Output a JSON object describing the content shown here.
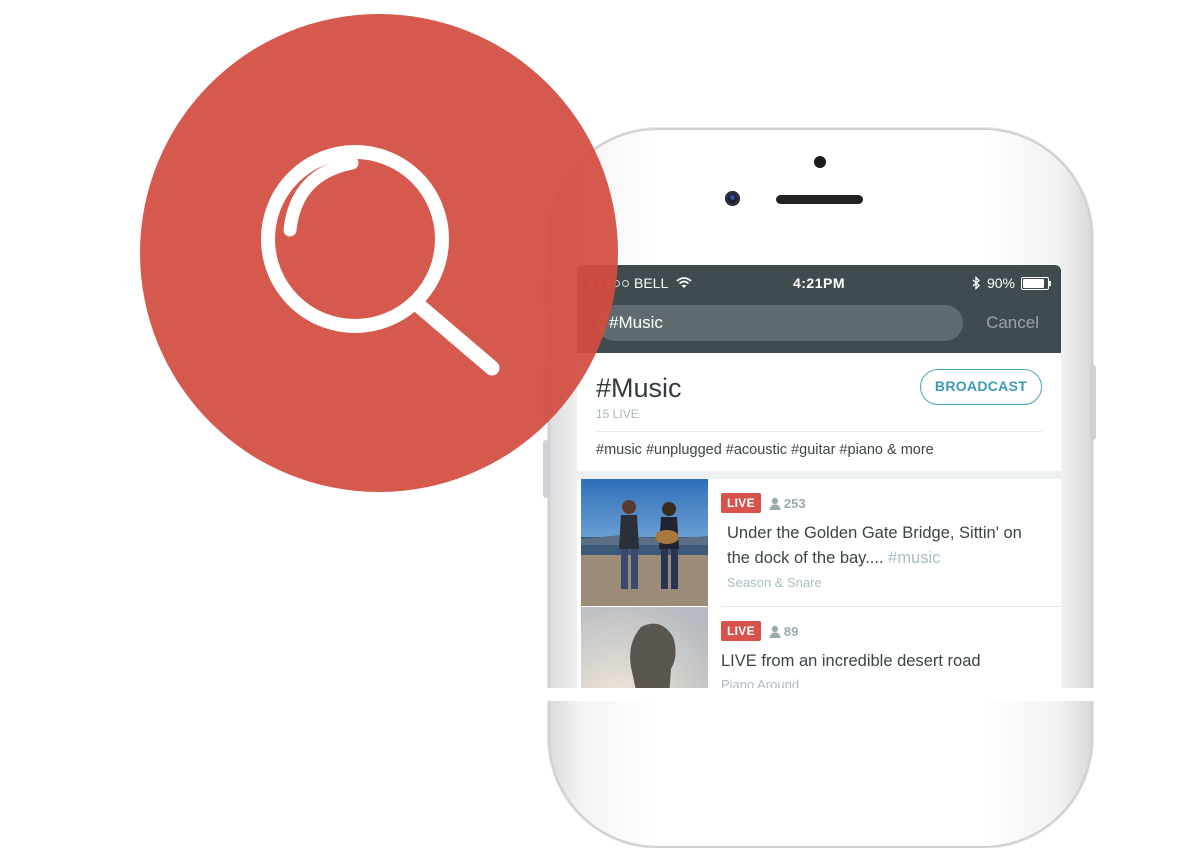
{
  "colors": {
    "accent_red": "#d34c40",
    "topbar": "#3f4b4f",
    "broadcast_blue": "#3a9bb3",
    "live_badge": "#d7524a"
  },
  "status_bar": {
    "carrier": "BELL",
    "time": "4:21PM",
    "battery": "90%",
    "icons": [
      "wifi-icon",
      "bluetooth-icon",
      "battery-icon"
    ]
  },
  "search": {
    "value": "#Music",
    "cancel_label": "Cancel"
  },
  "channel": {
    "title": "#Music",
    "live_count": "15 LIVE",
    "broadcast_label": "BROADCAST",
    "tags": "#music #unplugged #acoustic #guitar #piano & more"
  },
  "streams": [
    {
      "live_label": "LIVE",
      "viewers": "253",
      "description": "Under the Golden Gate Bridge, Sittin' on the dock of the bay....",
      "hashtag": "#music",
      "author": "Season & Snare"
    },
    {
      "live_label": "LIVE",
      "viewers": "89",
      "description": "LIVE from an incredible desert road",
      "hashtag": "",
      "author": "Piano Around"
    }
  ]
}
